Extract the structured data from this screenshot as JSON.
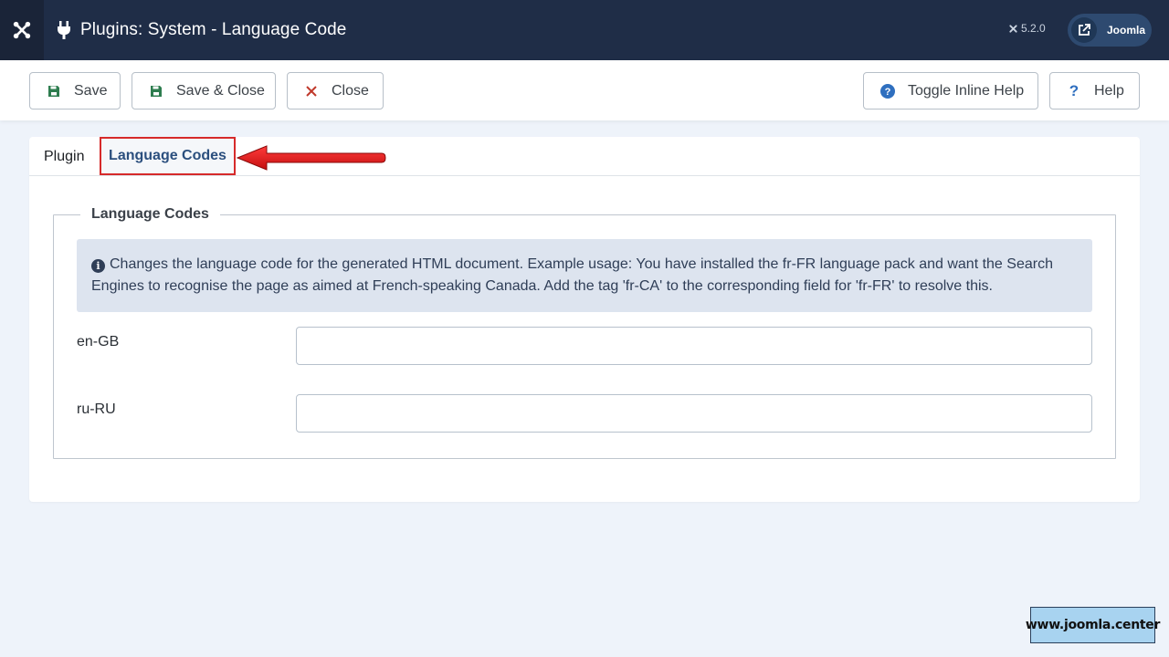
{
  "header": {
    "title": "Plugins: System - Language Code",
    "version": "5.2.0",
    "site_button_label": "Joomla"
  },
  "toolbar": {
    "save_label": "Save",
    "save_close_label": "Save & Close",
    "close_label": "Close",
    "toggle_help_label": "Toggle Inline Help",
    "help_label": "Help"
  },
  "tabs": [
    {
      "label": "Plugin",
      "active": false
    },
    {
      "label": "Language Codes",
      "active": true
    }
  ],
  "fieldset": {
    "legend": "Language Codes",
    "info_text": "Changes the language code for the generated HTML document. Example usage: You have installed the fr-FR language pack and want the Search Engines to recognise the page as aimed at French-speaking Canada. Add the tag 'fr-CA' to the corresponding field for 'fr-FR' to resolve this.",
    "fields": [
      {
        "label": "en-GB",
        "value": ""
      },
      {
        "label": "ru-RU",
        "value": ""
      }
    ]
  },
  "watermark": "www.joomla.center",
  "colors": {
    "header_bg": "#1f2d47",
    "page_bg": "#eef3fa",
    "active_tab_text": "#2b4f7e",
    "highlight_red": "#d62a2a",
    "info_bg": "#dde4ef",
    "save_icon": "#2e7d4f",
    "close_icon": "#c0392b",
    "help_icon": "#2f6fbf"
  }
}
